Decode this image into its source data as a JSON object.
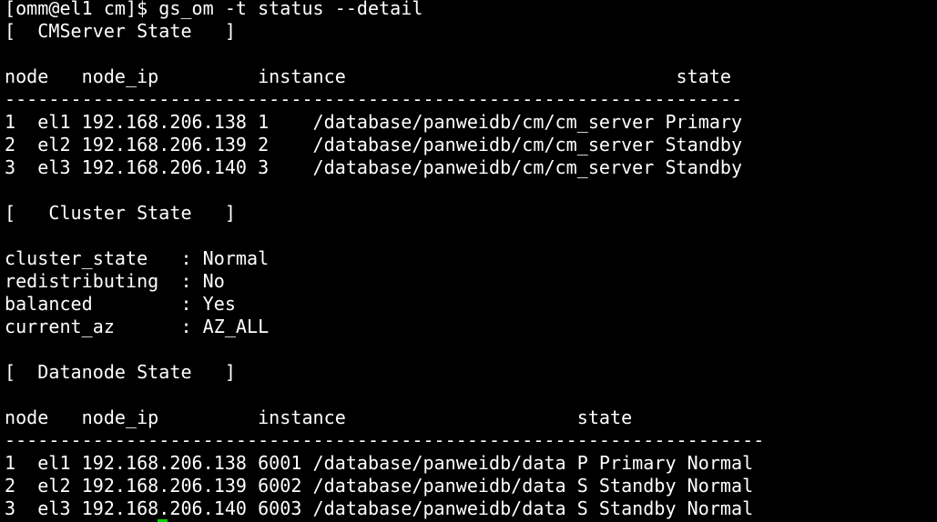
{
  "terminal": {
    "prompt_line": "[omm@el1 cm]$ gs_om -t status --detail",
    "cm_section": {
      "title": "[  CMServer State   ]",
      "header": "node   node_ip         instance                              state",
      "separator": "-------------------------------------------------------------------",
      "rows": [
        "1  el1 192.168.206.138 1    /database/panweidb/cm/cm_server Primary",
        "2  el2 192.168.206.139 2    /database/panweidb/cm/cm_server Standby",
        "3  el3 192.168.206.140 3    /database/panweidb/cm/cm_server Standby"
      ]
    },
    "cluster_section": {
      "title": "[   Cluster State   ]",
      "rows": [
        "cluster_state   : Normal",
        "redistributing  : No",
        "balanced        : Yes",
        "current_az      : AZ_ALL"
      ]
    },
    "dn_section": {
      "title": "[  Datanode State   ]",
      "header": "node   node_ip         instance                     state",
      "separator": "---------------------------------------------------------------------",
      "rows": [
        "1  el1 192.168.206.138 6001 /database/panweidb/data P Primary Normal",
        "2  el2 192.168.206.139 6002 /database/panweidb/data S Standby Normal",
        "3  el3 192.168.206.140 6003 /database/panweidb/data S Standby Normal"
      ]
    }
  },
  "colors": {
    "background": "#000000",
    "text": "#ffffff",
    "cursor": "#00d000"
  }
}
